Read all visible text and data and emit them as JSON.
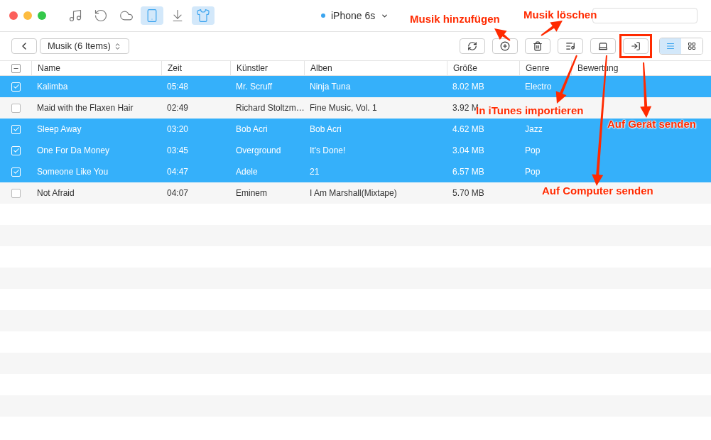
{
  "toolbar_tabs": [
    {
      "kind": "music",
      "selected": false
    },
    {
      "kind": "restore",
      "selected": false
    },
    {
      "kind": "cloud",
      "selected": false
    },
    {
      "kind": "device",
      "selected": true
    },
    {
      "kind": "download",
      "selected": false
    },
    {
      "kind": "shirt",
      "selected": true
    }
  ],
  "device": {
    "name": "iPhone 6s",
    "connected": true
  },
  "category": "Musik (6 Items)",
  "select_all": {
    "indeterminate": true
  },
  "actions": [
    {
      "kind": "refresh"
    },
    {
      "kind": "add"
    },
    {
      "kind": "delete"
    },
    {
      "kind": "itunes"
    },
    {
      "kind": "computer"
    },
    {
      "kind": "to_device",
      "highlighted": true
    }
  ],
  "view_toggle": [
    {
      "kind": "list",
      "selected": true
    },
    {
      "kind": "grid",
      "selected": false
    }
  ],
  "table": {
    "columns": [
      "Name",
      "Zeit",
      "Künstler",
      "Alben",
      "Größe",
      "Genre",
      "Bewertung"
    ],
    "rows": [
      {
        "checked": true,
        "cells": [
          "Kalimba",
          "05:48",
          "Mr. Scruff",
          "Ninja Tuna",
          "8.02 MB",
          "Electro"
        ]
      },
      {
        "checked": false,
        "cells": [
          "Maid with the Flaxen Hair",
          "02:49",
          "Richard Stoltzm…",
          "Fine Music, Vol. 1",
          "3.92 M"
        ]
      },
      {
        "checked": true,
        "cells": [
          "Sleep Away",
          "03:20",
          "Bob Acri",
          "Bob Acri",
          "4.62 MB",
          "Jazz"
        ]
      },
      {
        "checked": true,
        "cells": [
          "One For Da Money",
          "03:45",
          "Overground",
          "It's Done!",
          "3.04 MB",
          "Pop"
        ]
      },
      {
        "checked": true,
        "cells": [
          "Someone Like You",
          "04:47",
          "Adele",
          "21",
          "6.57 MB",
          "Pop"
        ]
      },
      {
        "checked": false,
        "cells": [
          "Not Afraid",
          "04:07",
          "Eminem",
          "I Am Marshall(Mixtape)",
          "5.70 MB"
        ]
      }
    ]
  },
  "annotations": [
    {
      "text": "Musik hinzufügen"
    },
    {
      "text": "Musik löschen"
    },
    {
      "text": "In iTunes importieren"
    },
    {
      "text": "Auf Gerät senden"
    },
    {
      "text": "Auf Computer senden"
    }
  ]
}
